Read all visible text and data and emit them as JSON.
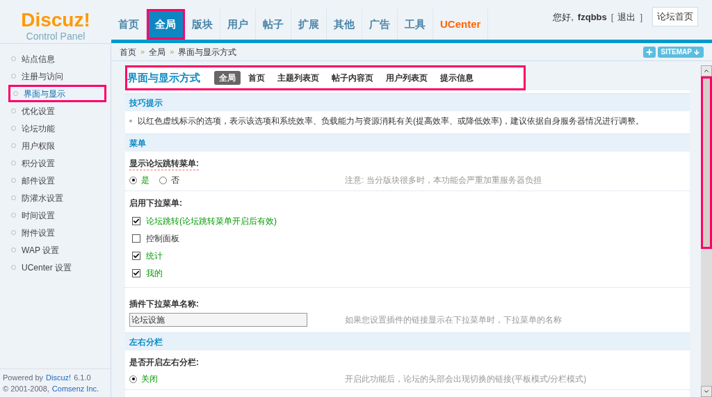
{
  "logo": {
    "name": "Discuz!",
    "subtitle": "Control Panel"
  },
  "nav": [
    {
      "label": "首页",
      "selected": false,
      "kind": "normal"
    },
    {
      "label": "全局",
      "selected": true,
      "kind": "normal"
    },
    {
      "label": "版块",
      "selected": false,
      "kind": "normal"
    },
    {
      "label": "用户",
      "selected": false,
      "kind": "normal"
    },
    {
      "label": "帖子",
      "selected": false,
      "kind": "normal"
    },
    {
      "label": "扩展",
      "selected": false,
      "kind": "normal"
    },
    {
      "label": "其他",
      "selected": false,
      "kind": "normal"
    },
    {
      "label": "广告",
      "selected": false,
      "kind": "normal"
    },
    {
      "label": "工具",
      "selected": false,
      "kind": "normal"
    },
    {
      "label": "UCenter",
      "selected": false,
      "kind": "highlight"
    }
  ],
  "user": {
    "greeting": "您好,",
    "username": "fzqbbs",
    "bracket_open": "[",
    "logout": "退出",
    "bracket_close": "]",
    "home_button": "论坛首页"
  },
  "breadcrumb": {
    "separator": "»",
    "items": [
      "首页",
      "全局",
      "界面与显示方式"
    ]
  },
  "sitemap_button": "SITEMAP",
  "sidebar": {
    "items": [
      {
        "label": "站点信息",
        "selected": false
      },
      {
        "label": "注册与访问",
        "selected": false
      },
      {
        "label": "界面与显示",
        "selected": true
      },
      {
        "label": "优化设置",
        "selected": false
      },
      {
        "label": "论坛功能",
        "selected": false
      },
      {
        "label": "用户权限",
        "selected": false
      },
      {
        "label": "积分设置",
        "selected": false
      },
      {
        "label": "邮件设置",
        "selected": false
      },
      {
        "label": "防灌水设置",
        "selected": false
      },
      {
        "label": "时间设置",
        "selected": false
      },
      {
        "label": "附件设置",
        "selected": false
      },
      {
        "label": "WAP 设置",
        "selected": false
      },
      {
        "label": "UCenter 设置",
        "selected": false
      }
    ],
    "footer": {
      "powered_by": "Powered by",
      "brand": "Discuz!",
      "version": "6.1.0",
      "copyright": "© 2001-2008,",
      "company": "Comsenz Inc."
    }
  },
  "page": {
    "title": "界面与显示方式",
    "tabs": [
      {
        "label": "全局",
        "selected": true
      },
      {
        "label": "首页",
        "selected": false
      },
      {
        "label": "主题列表页",
        "selected": false
      },
      {
        "label": "帖子内容页",
        "selected": false
      },
      {
        "label": "用户列表页",
        "selected": false
      },
      {
        "label": "提示信息",
        "selected": false
      }
    ]
  },
  "sections": [
    {
      "kind": "header",
      "title": "技巧提示"
    },
    {
      "kind": "tip",
      "text": "以红色虚线标示的选项，表示该选项和系统效率、负载能力与资源消耗有关(提高效率、或降低效率)，建议依据自身服务器情况进行调整。"
    },
    {
      "kind": "header",
      "title": "菜单"
    },
    {
      "kind": "radio",
      "label": "显示论坛跳转菜单:",
      "important": true,
      "options": [
        {
          "label": "是",
          "selected": true
        },
        {
          "label": "否",
          "selected": false
        }
      ],
      "note": "注意: 当分版块很多时，本功能会严重加重服务器负担"
    },
    {
      "kind": "checkbox",
      "label": "启用下拉菜单:",
      "important": false,
      "options": [
        {
          "label": "论坛跳转(论坛跳转菜单开启后有效)",
          "checked": true
        },
        {
          "label": "控制面板",
          "checked": false
        },
        {
          "label": "统计",
          "checked": true
        },
        {
          "label": "我的",
          "checked": true
        }
      ]
    },
    {
      "kind": "text",
      "label": "插件下拉菜单名称:",
      "important": false,
      "value": "论坛设施",
      "note": "如果您设置插件的链接显示在下拉菜单时，下拉菜单的名称"
    },
    {
      "kind": "header",
      "title": "左右分栏"
    },
    {
      "kind": "radio",
      "label": "是否开启左右分栏:",
      "important": false,
      "options": [
        {
          "label": "关闭",
          "selected": true
        }
      ],
      "note": "开启此功能后，论坛的头部会出现切换的链接(平板模式/分栏模式)"
    }
  ]
}
